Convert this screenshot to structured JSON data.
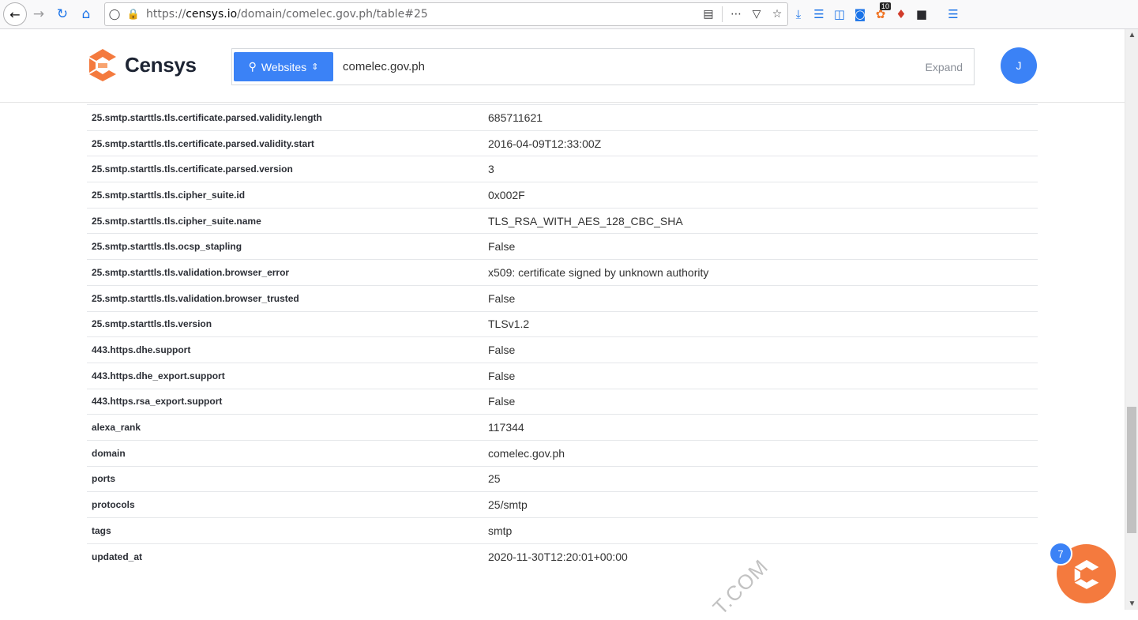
{
  "browser": {
    "url_prefix": "https://",
    "url_domain": "censys.io",
    "url_path": "/domain/comelec.gov.ph/table#25",
    "notification_count": "10"
  },
  "header": {
    "logo_text": "Censys",
    "search_type_label": "Websites",
    "search_value": "comelec.gov.ph",
    "expand_label": "Expand",
    "avatar_initial": "J"
  },
  "table": {
    "rows": [
      {
        "key": "25.smtp.starttls.tls.certificate.parsed.validity.length",
        "value": "685711621"
      },
      {
        "key": "25.smtp.starttls.tls.certificate.parsed.validity.start",
        "value": "2016-04-09T12:33:00Z"
      },
      {
        "key": "25.smtp.starttls.tls.certificate.parsed.version",
        "value": "3"
      },
      {
        "key": "25.smtp.starttls.tls.cipher_suite.id",
        "value": "0x002F"
      },
      {
        "key": "25.smtp.starttls.tls.cipher_suite.name",
        "value": "TLS_RSA_WITH_AES_128_CBC_SHA"
      },
      {
        "key": "25.smtp.starttls.tls.ocsp_stapling",
        "value": "False"
      },
      {
        "key": "25.smtp.starttls.tls.validation.browser_error",
        "value": "x509: certificate signed by unknown authority"
      },
      {
        "key": "25.smtp.starttls.tls.validation.browser_trusted",
        "value": "False"
      },
      {
        "key": "25.smtp.starttls.tls.version",
        "value": "TLSv1.2"
      },
      {
        "key": "443.https.dhe.support",
        "value": "False"
      },
      {
        "key": "443.https.dhe_export.support",
        "value": "False"
      },
      {
        "key": "443.https.rsa_export.support",
        "value": "False"
      },
      {
        "key": "alexa_rank",
        "value": "117344"
      },
      {
        "key": "domain",
        "value": "comelec.gov.ph"
      },
      {
        "key": "ports",
        "value": "25"
      },
      {
        "key": "protocols",
        "value": "25/smtp"
      },
      {
        "key": "tags",
        "value": "smtp"
      },
      {
        "key": "updated_at",
        "value": "2020-11-30T12:20:01+00:00"
      }
    ]
  },
  "chat": {
    "badge_count": "7"
  },
  "watermark": "T.COM",
  "colors": {
    "accent": "#3b82f6",
    "brand_orange": "#f47a3e"
  }
}
